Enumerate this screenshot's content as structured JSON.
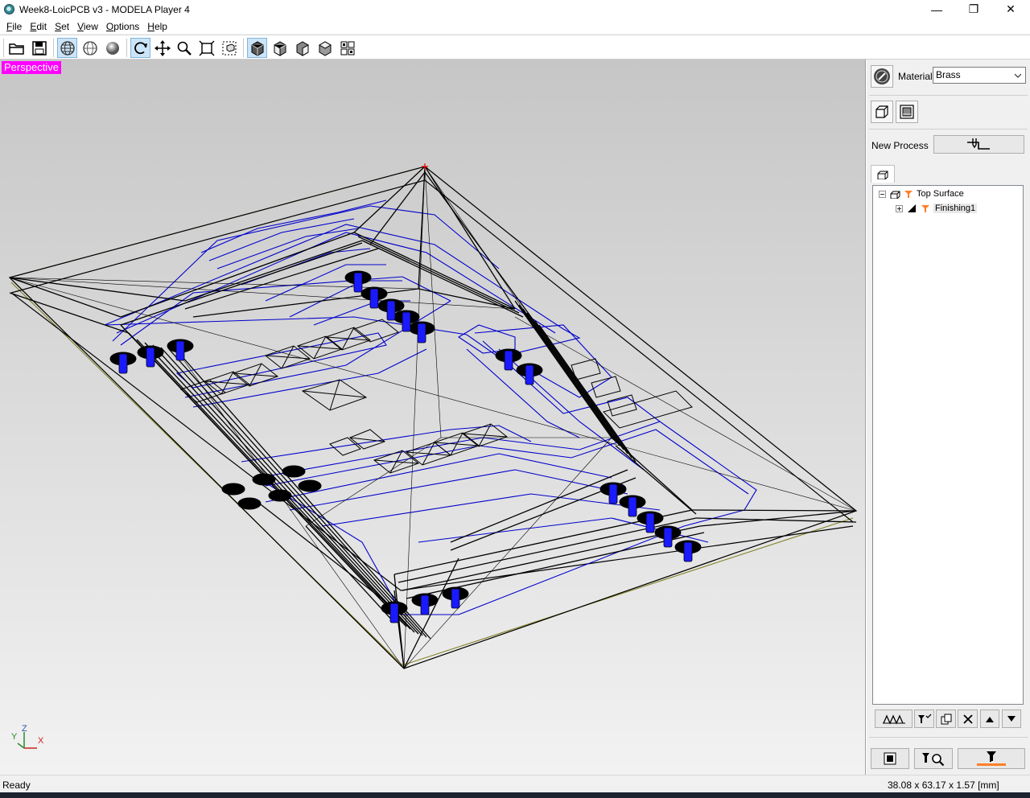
{
  "window": {
    "title": "Week8-LoicPCB v3 - MODELA Player 4",
    "controls": {
      "minimize": "—",
      "maximize": "❐",
      "close": "✕"
    }
  },
  "menu": [
    {
      "label": "File",
      "underline": "F",
      "rest": "ile"
    },
    {
      "label": "Edit",
      "underline": "E",
      "rest": "dit"
    },
    {
      "label": "Set",
      "underline": "S",
      "rest": "et"
    },
    {
      "label": "View",
      "underline": "V",
      "rest": "iew"
    },
    {
      "label": "Options",
      "underline": "O",
      "rest": "ptions"
    },
    {
      "label": "Help",
      "underline": "H",
      "rest": "elp"
    }
  ],
  "toolbar": {
    "buttons": [
      {
        "icon": "open-folder-icon",
        "active": false
      },
      {
        "icon": "save-icon",
        "active": false
      },
      {
        "icon": "wireframe-sphere-icon",
        "active": true
      },
      {
        "icon": "line-sphere-icon",
        "active": false
      },
      {
        "icon": "shaded-sphere-icon",
        "active": false
      },
      {
        "icon": "rotate-icon",
        "active": true
      },
      {
        "icon": "pan-icon",
        "active": false
      },
      {
        "icon": "zoom-icon",
        "active": false
      },
      {
        "icon": "fit-window-icon",
        "active": false
      },
      {
        "icon": "zoom-box-icon",
        "active": false
      },
      {
        "icon": "perspective-view-icon",
        "active": true
      },
      {
        "icon": "front-view-icon",
        "active": false
      },
      {
        "icon": "side-view-icon",
        "active": false
      },
      {
        "icon": "back-view-icon",
        "active": false
      },
      {
        "icon": "multi-view-icon",
        "active": false
      }
    ]
  },
  "viewport": {
    "label": "Perspective",
    "axes": {
      "x": "X",
      "y": "Y",
      "z": "Z"
    },
    "colors": {
      "trace": "#0000cc",
      "pad": "#1a1aff",
      "wire": "#000000",
      "stock": "#7a7a1a"
    }
  },
  "panel": {
    "material_label": "Material",
    "material_value": "Brass",
    "new_process_label": "New Process",
    "tree": [
      {
        "label": "Top Surface",
        "level": 0,
        "expander": "minus"
      },
      {
        "label": "Finishing1",
        "level": 1,
        "expander": "plus"
      }
    ]
  },
  "status": {
    "left": "Ready",
    "right": "38.08 x 63.17 x 1.57 [mm]"
  }
}
